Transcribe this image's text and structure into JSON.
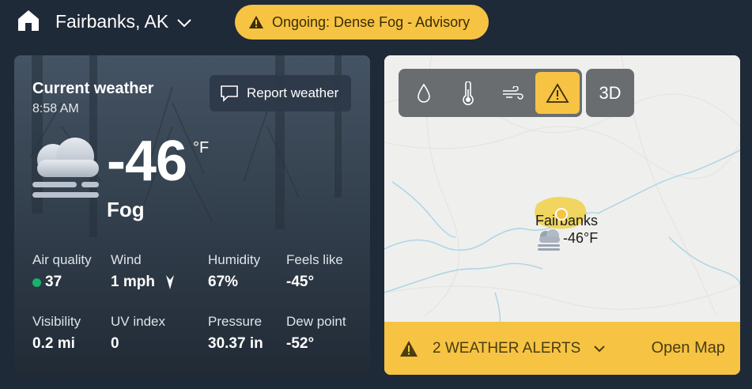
{
  "header": {
    "home_icon": "home-icon",
    "location": "Fairbanks, AK",
    "advisory": "Ongoing: Dense Fog - Advisory"
  },
  "current": {
    "title": "Current weather",
    "time": "8:58 AM",
    "report_label": "Report weather",
    "temperature": "-46",
    "unit": "°F",
    "condition": "Fog",
    "condition_icon": "fog-cloud-icon",
    "details": {
      "air_quality": {
        "label": "Air quality",
        "value": "37"
      },
      "wind": {
        "label": "Wind",
        "value": "1 mph"
      },
      "humidity": {
        "label": "Humidity",
        "value": "67%"
      },
      "feels_like": {
        "label": "Feels like",
        "value": "-45°"
      },
      "visibility": {
        "label": "Visibility",
        "value": "0.2 mi"
      },
      "uv_index": {
        "label": "UV index",
        "value": "0"
      },
      "pressure": {
        "label": "Pressure",
        "value": "30.37 in"
      },
      "dew_point": {
        "label": "Dew point",
        "value": "-52°"
      }
    }
  },
  "map": {
    "layers": [
      "precipitation-icon",
      "temperature-icon",
      "wind-icon",
      "alert-icon"
    ],
    "active_layer": "alert-icon",
    "btn_3d": "3D",
    "city": "Fairbanks",
    "city_temp": "-46°F",
    "alerts": "2 WEATHER ALERTS",
    "open_map": "Open Map"
  },
  "colors": {
    "background": "#1f2a38",
    "accent_yellow": "#f6c343",
    "aq_good": "#18b26b"
  }
}
